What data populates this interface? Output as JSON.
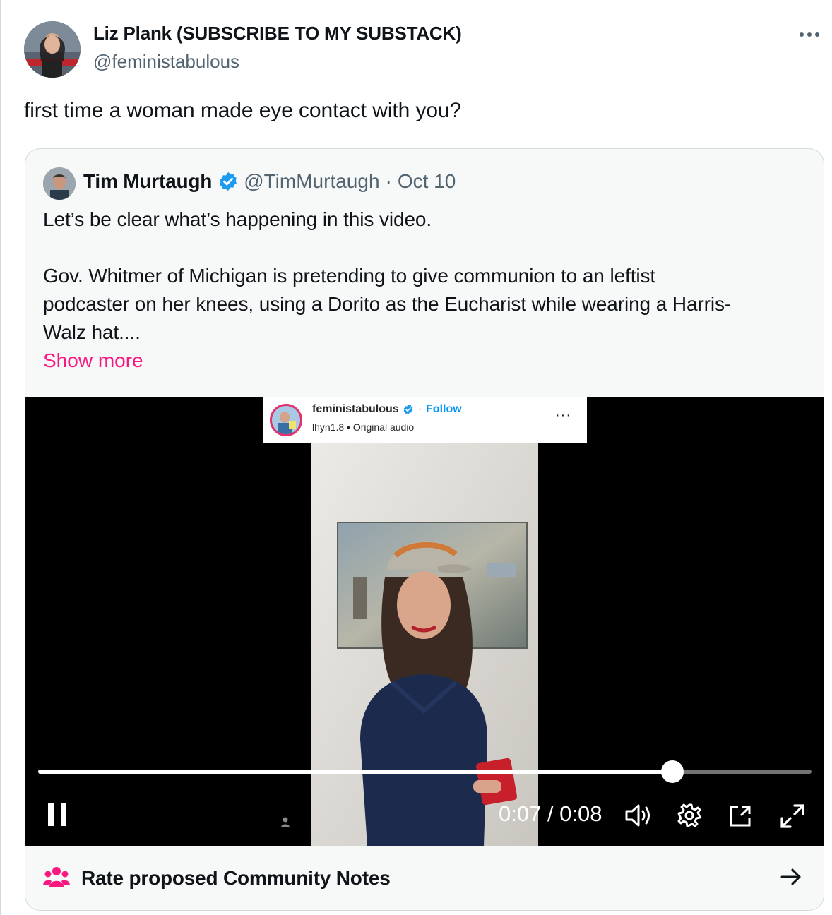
{
  "tweet": {
    "author_name": "Liz Plank (SUBSCRIBE TO MY SUBSTACK)",
    "author_handle": "@feministabulous",
    "text": "first time a woman made eye contact with you?"
  },
  "quoted_tweet": {
    "author_name": "Tim Murtaugh",
    "author_handle": "@TimMurtaugh",
    "separator": "·",
    "date": "Oct 10",
    "lines": [
      "Let’s be clear what’s happening in this video.",
      "Gov. Whitmer of Michigan is pretending to give communion to an leftist",
      "podcaster on her knees, using a Dorito as the Eucharist while wearing a Harris-",
      "Walz hat...."
    ],
    "show_more": "Show more"
  },
  "video": {
    "overlay": {
      "username": "feministabulous",
      "dot": "·",
      "follow": "Follow",
      "audio": "lhyn1.8 • Original audio",
      "more": "···"
    },
    "time_display": "0:07 / 0:08",
    "progress_fraction": 0.82
  },
  "community_notes": {
    "label": "Rate proposed Community Notes"
  },
  "icons": {
    "more": "more-horizontal-icon",
    "verified": "verified-badge-icon",
    "pause": "pause-icon",
    "volume": "volume-icon",
    "settings": "gear-icon",
    "pip": "picture-in-picture-icon",
    "fullscreen": "fullscreen-icon",
    "people": "people-icon",
    "arrow": "arrow-right-icon"
  },
  "colors": {
    "link_pink": "#f91880",
    "verified_blue": "#1d9bf0",
    "instagram_blue": "#0095f6",
    "secondary_text": "#536471"
  }
}
